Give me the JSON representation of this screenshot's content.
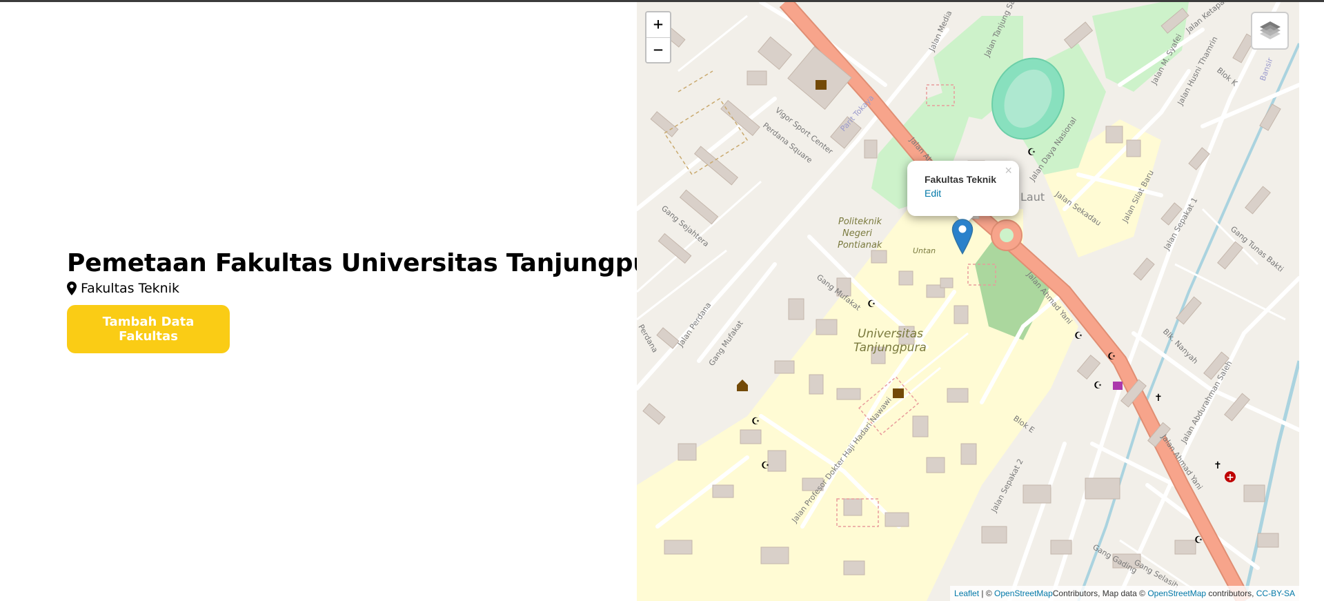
{
  "page": {
    "title": "Pemetaan Fakultas Universitas Tanjungpura",
    "location_label": "Fakultas Teknik",
    "add_button_label": "Tambah Data Fakultas"
  },
  "map": {
    "zoom_in_label": "+",
    "zoom_out_label": "−",
    "layers_icon": "layers-icon",
    "popup": {
      "title": "Fakultas Teknik",
      "edit_label": "Edit",
      "close_label": "×"
    },
    "marker_icon": "map-marker-icon",
    "attribution": {
      "leaflet": "Leaflet",
      "separator": " | © ",
      "osm_1": "OpenStreetMap",
      "contributors_map_data": "Contributors, Map data © ",
      "osm_2": "OpenStreetMap",
      "contributors": " contributors, ",
      "license": "CC-BY-SA"
    },
    "labels": {
      "university": [
        "Universitas",
        "Tanjungpura"
      ],
      "polytechnic": [
        "Politeknik",
        "Negeri",
        "Pontianak"
      ],
      "untan": "Untan",
      "laut": "Laut",
      "jalan_ahmad_yani_1": "Jalan Ahmad Yani",
      "jalan_ahmad_yani_2": "Jalan Ahmad Yani",
      "jalan_ahmad_yani_3": "Jalan Ahmad Yani",
      "jalan_daya_nasional": "Jalan Daya Nasional",
      "jalan_sekadau": "Jalan Sekadau",
      "gang_mufakat": "Gang Mufakat",
      "gang_mufakat_2": "Gang Mufakat",
      "jalan_perdana": "Jalan Perdana",
      "gang_sejahtera": "Gang Sejahtera",
      "vigor": "Vigor Sport Center",
      "perdana_square": "Perdana Square",
      "parit_tokaya": "Parit Tokaya",
      "jalan_profesor": "Jalan Profesor Dokter Haji Hadari Nawawi",
      "jalan_sepakat_2": "Jalan Sepakat 2",
      "jalan_sepakat_1": "Jalan Sepakat 1",
      "gang_tunas_bakti": "Gang Tunas Bakti",
      "jalan_abdurahman_saleh": "Jalan Abdurahman Saleh",
      "gang_gading": "Gang Gading",
      "gang_selasih": "Gang Selasih",
      "jalan_media": "Jalan Media",
      "jalan_tanjung_sari": "Jalan Tanjung Sari",
      "jalan_silat_baru": "Jalan Silat Baru",
      "jalan_husni_thamrin": "Jalan Husni Thamrin",
      "jalan_ketapang": "Jalan Ketapang",
      "jalan_m_syafei": "Jalan M. Syafei",
      "blk_nanyah": "Blk. Nanyah",
      "blok_k": "Blok K",
      "blok_e": "Blok E",
      "bansir": "Bansir",
      "perdana": "Perdana"
    }
  },
  "colors": {
    "accent": "#facc15",
    "link": "#0078a8",
    "marker": "#2a81cb",
    "road_primary": "#f7a48b",
    "campus": "#fffbd4",
    "park": "#cdf2ca",
    "pitch": "#88e0be",
    "building": "#d9d0c9",
    "land": "#f2efe9"
  }
}
